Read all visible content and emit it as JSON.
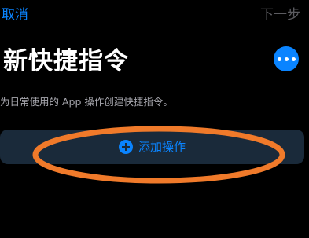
{
  "nav": {
    "cancel_label": "取消",
    "next_label": "下一步"
  },
  "header": {
    "title": "新快捷指令",
    "more_icon": "ellipsis-icon"
  },
  "main": {
    "description": "为日常使用的 App 操作创建快捷指令。",
    "add_action": {
      "icon": "plus-circle-icon",
      "label": "添加操作"
    }
  },
  "colors": {
    "background": "#000000",
    "accent": "#0a84ff",
    "button_bg": "#1a2a3a",
    "disabled_text": "#5b5b60",
    "secondary_text": "#a6a6ad",
    "annotation": "#f07a2a"
  }
}
